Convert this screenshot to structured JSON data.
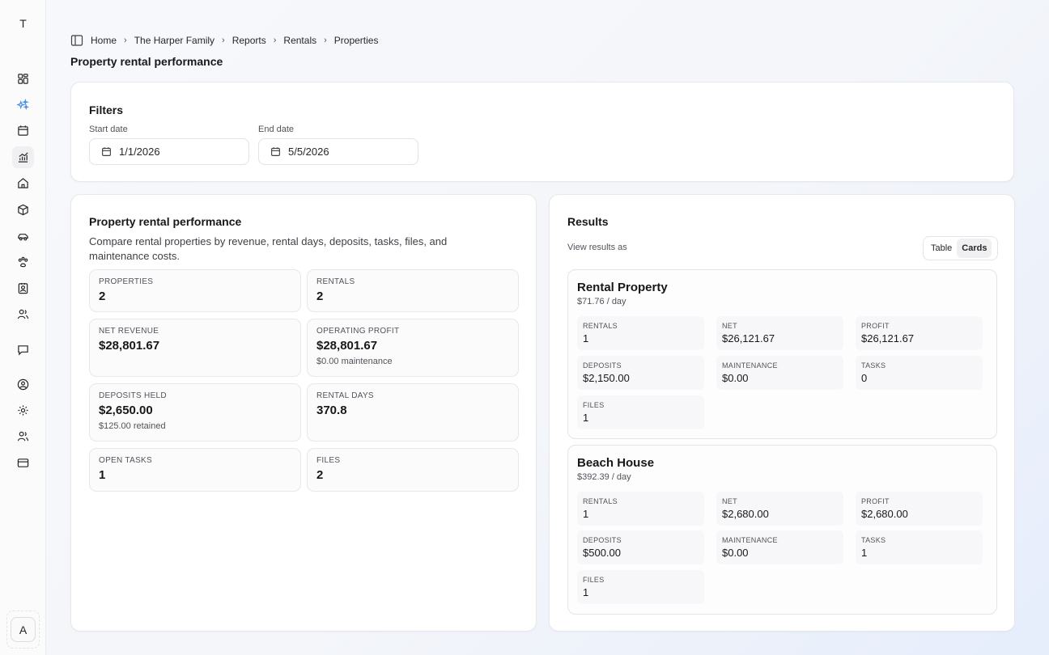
{
  "workspace_initial": "T",
  "user_initial": "A",
  "nav": {
    "icons": [
      "dashboard-icon",
      "sparkles-icon",
      "calendar-icon",
      "chart-icon",
      "home-icon",
      "package-icon",
      "car-icon",
      "paw-icon",
      "contact-icon",
      "users-icon",
      "message-icon",
      "user-circle-icon",
      "settings-icon",
      "team-icon",
      "credit-card-icon"
    ],
    "active": "chart-icon"
  },
  "breadcrumb": [
    "Home",
    "The Harper Family",
    "Reports",
    "Rentals",
    "Properties"
  ],
  "page_title": "Property rental performance",
  "filters": {
    "title": "Filters",
    "start_label": "Start date",
    "start_value": "1/1/2026",
    "end_label": "End date",
    "end_value": "5/5/2026"
  },
  "performance": {
    "title": "Property rental performance",
    "description": "Compare rental properties by revenue, rental days, deposits, tasks, files, and maintenance costs.",
    "stats": [
      {
        "label": "Properties",
        "value": "2",
        "sub": ""
      },
      {
        "label": "Rentals",
        "value": "2",
        "sub": ""
      },
      {
        "label": "Net revenue",
        "value": "$28,801.67",
        "sub": ""
      },
      {
        "label": "Operating profit",
        "value": "$28,801.67",
        "sub": "$0.00 maintenance"
      },
      {
        "label": "Deposits held",
        "value": "$2,650.00",
        "sub": "$125.00 retained"
      },
      {
        "label": "Rental days",
        "value": "370.8",
        "sub": ""
      },
      {
        "label": "Open tasks",
        "value": "1",
        "sub": ""
      },
      {
        "label": "Files",
        "value": "2",
        "sub": ""
      }
    ]
  },
  "results": {
    "title": "Results",
    "view_label": "View results as",
    "toggle": {
      "table": "Table",
      "cards": "Cards",
      "selected": "Cards"
    },
    "properties": [
      {
        "name": "Rental Property",
        "rate": "$71.76 / day",
        "cells": [
          {
            "label": "Rentals",
            "value": "1"
          },
          {
            "label": "Net",
            "value": "$26,121.67"
          },
          {
            "label": "Profit",
            "value": "$26,121.67"
          },
          {
            "label": "Deposits",
            "value": "$2,150.00"
          },
          {
            "label": "Maintenance",
            "value": "$0.00"
          },
          {
            "label": "Tasks",
            "value": "0"
          },
          {
            "label": "Files",
            "value": "1"
          }
        ]
      },
      {
        "name": "Beach House",
        "rate": "$392.39 / day",
        "cells": [
          {
            "label": "Rentals",
            "value": "1"
          },
          {
            "label": "Net",
            "value": "$2,680.00"
          },
          {
            "label": "Profit",
            "value": "$2,680.00"
          },
          {
            "label": "Deposits",
            "value": "$500.00"
          },
          {
            "label": "Maintenance",
            "value": "$0.00"
          },
          {
            "label": "Tasks",
            "value": "1"
          },
          {
            "label": "Files",
            "value": "1"
          }
        ]
      }
    ]
  }
}
